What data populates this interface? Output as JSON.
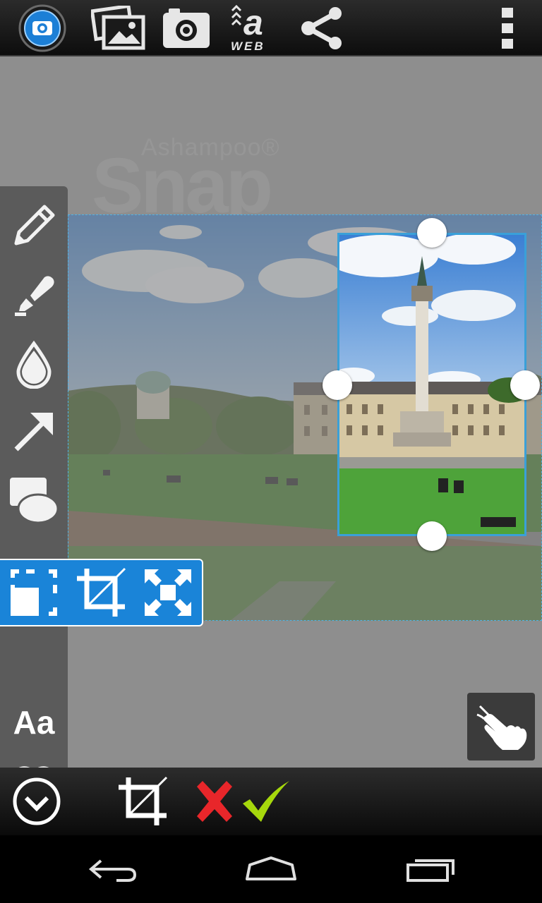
{
  "topbar": {
    "icons": [
      "camera-lens-icon",
      "gallery-icon",
      "photo-camera-icon",
      "web-icon",
      "share-icon",
      "overflow-menu-icon"
    ],
    "web_letter": "a",
    "web_label": "WEB"
  },
  "canvas": {
    "watermark_brand": "Ashampoo®",
    "watermark_product": "Snap"
  },
  "tools": {
    "items": [
      "pencil-icon",
      "marker-icon",
      "blur-drop-icon",
      "arrow-icon",
      "shapes-icon",
      "crop-tools",
      "text-tool",
      "stamp-heart-icon"
    ],
    "text_label": "Aa"
  },
  "cropbar": {
    "items": [
      "crop-select-icon",
      "crop-icon",
      "fit-expand-icon"
    ]
  },
  "actionbar": {
    "items": [
      "collapse-chevron-icon",
      "crop-icon",
      "cancel-icon",
      "confirm-icon"
    ]
  },
  "colors": {
    "accent": "#1a84d8",
    "selection": "#3aa0d8",
    "cancel": "#e8262a",
    "confirm": "#a6d80c"
  }
}
